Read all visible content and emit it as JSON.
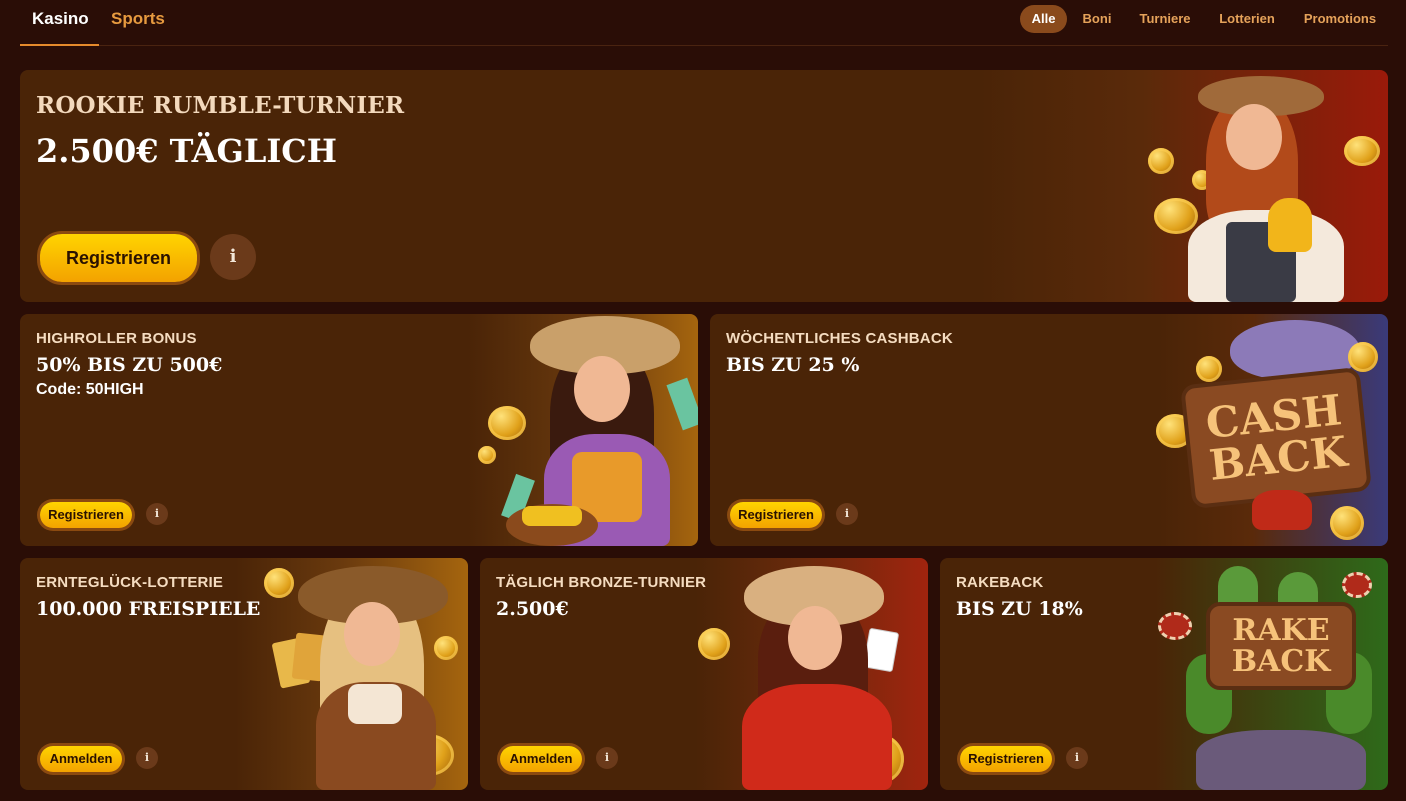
{
  "nav": {
    "tabs": [
      {
        "label": "Kasino",
        "active": true
      },
      {
        "label": "Sports",
        "active": false
      }
    ],
    "filters": [
      {
        "label": "Alle",
        "active": true
      },
      {
        "label": "Boni"
      },
      {
        "label": "Turniere"
      },
      {
        "label": "Lotterien"
      },
      {
        "label": "Promotions"
      }
    ]
  },
  "hero": {
    "eyebrow": "ROOKIE RUMBLE-TURNIER",
    "headline": "2.500€ TÄGLICH",
    "cta": "Registrieren",
    "info_icon": "info-icon"
  },
  "cards": [
    {
      "eyebrow": "HIGHROLLER BONUS",
      "headline": "50% BIS ZU 500€",
      "code": "Code: 50HIGH",
      "cta": "Registrieren"
    },
    {
      "eyebrow": "WÖCHENTLICHES CASHBACK",
      "headline": "BIS ZU 25 %",
      "cta": "Registrieren",
      "sign_line1": "CASH",
      "sign_line2": "BACK"
    },
    {
      "eyebrow": "ERNTEGLÜCK-LOTTERIE",
      "headline": "100.000 FREISPIELE",
      "cta": "Anmelden"
    },
    {
      "eyebrow": "TÄGLICH BRONZE-TURNIER",
      "headline": "2.500€",
      "cta": "Anmelden"
    },
    {
      "eyebrow": "RAKEBACK",
      "headline": "BIS ZU 18%",
      "cta": "Registrieren",
      "sign_line1": "RAKE",
      "sign_line2": "BACK"
    }
  ],
  "colors": {
    "background": "#2a0d06",
    "card": "#4a2407",
    "accent_orange": "#e79a3f",
    "button_yellow": "#ffc400"
  }
}
